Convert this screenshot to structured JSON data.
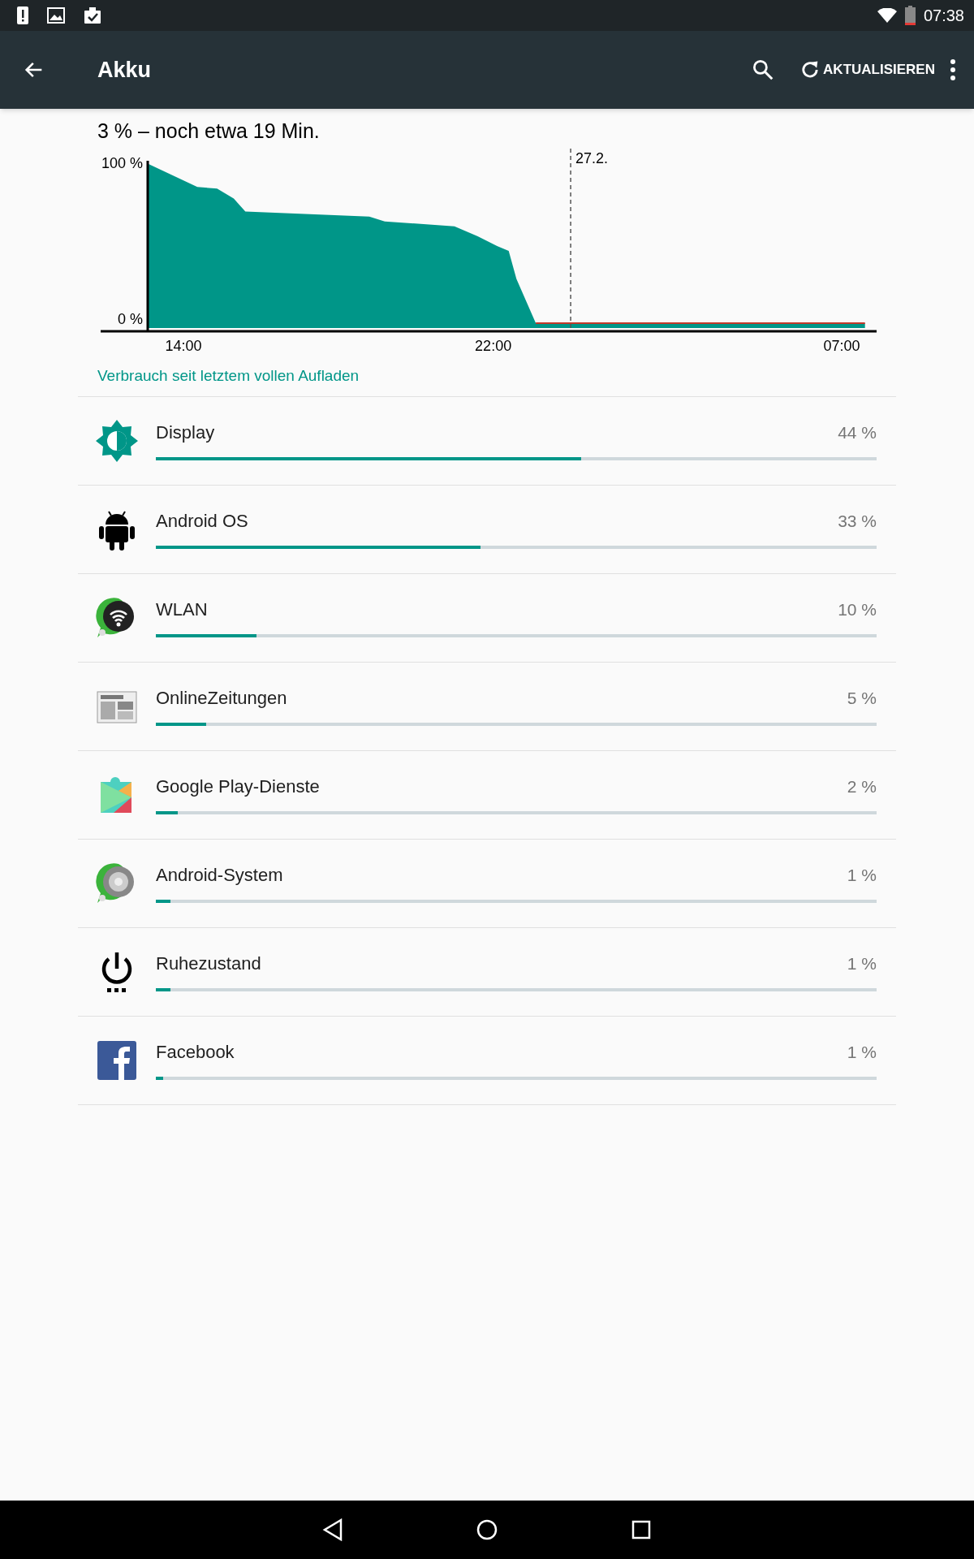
{
  "status_bar": {
    "time": "07:38"
  },
  "toolbar": {
    "title": "Akku",
    "action": "AKTUALISIEREN"
  },
  "summary": "3 % – noch etwa 19 Min.",
  "battery_chart": {
    "y_ticks": [
      "100 %",
      "0 %"
    ],
    "x_ticks": [
      "14:00",
      "22:00",
      "07:00"
    ],
    "date_marker": "27.2."
  },
  "section_title": "Verbrauch seit letztem vollen Aufladen",
  "items": [
    {
      "kind": "display",
      "name": "Display",
      "percent": "44 %",
      "level": 0.59
    },
    {
      "kind": "android",
      "name": "Android OS",
      "percent": "33 %",
      "level": 0.45
    },
    {
      "kind": "wifi",
      "name": "WLAN",
      "percent": "10 %",
      "level": 0.14
    },
    {
      "kind": "newspaper",
      "name": "OnlineZeitungen",
      "percent": "5 %",
      "level": 0.07
    },
    {
      "kind": "puzzle",
      "name": "Google Play-Dienste",
      "percent": "2 %",
      "level": 0.03
    },
    {
      "kind": "disc",
      "name": "Android-System",
      "percent": "1 %",
      "level": 0.02
    },
    {
      "kind": "power",
      "name": "Ruhezustand",
      "percent": "1 %",
      "level": 0.02
    },
    {
      "kind": "facebook",
      "name": "Facebook",
      "percent": "1 %",
      "level": 0.01
    }
  ]
}
